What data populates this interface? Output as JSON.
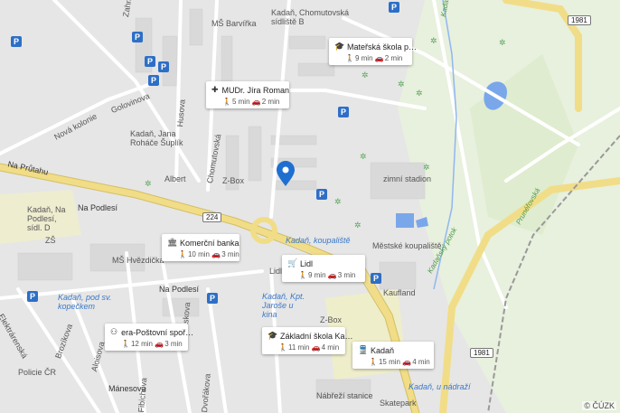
{
  "map": {
    "road_numbers": [
      "1981",
      "224",
      "1981"
    ],
    "street_labels": [
      "Zahradní",
      "Golovinova",
      "Nová kolonie",
      "Husova",
      "Chomutovská",
      "Na Průtahu",
      "Na Podlesí",
      "Na Podlesí",
      "Mánesova",
      "Brozíkova",
      "Aloisova",
      "Elektrárenská",
      "Fibichova",
      "Dvořákova",
      "Jiráskova",
      "Kadaňský potok",
      "Kadaňský potok",
      "Prunéřovská"
    ],
    "place_labels": [
      "Kadaň, Chomutovská sídliště B",
      "MŠ Barvířka",
      "Kadaň, Jana Roháče Šuplík",
      "Albert",
      "Z-Box",
      "zimní stadion",
      "Kadaň, Na Podlesí, sídl. D",
      "ZŠ",
      "MŠ Hvězdička",
      "Městské koupaliště",
      "Kaufland",
      "Policie ČR",
      "Z-Box",
      "Nábřeží stanice",
      "Skatepark",
      "Lidl"
    ],
    "transit_labels": [
      "Kadaň, koupaliště",
      "Kadaň, pod sv. kopečkem",
      "Kadaň, Kpt. Jaroše u kina",
      "Kadaň, u nádraží"
    ],
    "copyright": "© ČÚZK"
  },
  "cards": [
    {
      "icon": "school-icon",
      "glyph": "🎓",
      "title": "Mateřská škola p…",
      "walk": "9 min",
      "car": "2 min"
    },
    {
      "icon": "doctor-icon",
      "glyph": "✚",
      "title": "MUDr. Jíra Roman",
      "walk": "5 min",
      "car": "2 min"
    },
    {
      "icon": "bank-icon",
      "glyph": "🏛",
      "title": "Komerční banka",
      "walk": "10 min",
      "car": "3 min"
    },
    {
      "icon": "shop-icon",
      "glyph": "🛒",
      "title": "Lidl",
      "walk": "9 min",
      "car": "3 min"
    },
    {
      "icon": "atm-icon",
      "glyph": "⚇",
      "title": "era-Poštovní spoř…",
      "walk": "12 min",
      "car": "3 min"
    },
    {
      "icon": "school-icon",
      "glyph": "🎓",
      "title": "Základní škola Ka…",
      "walk": "11 min",
      "car": "4 min"
    },
    {
      "icon": "train-icon",
      "glyph": "🚆",
      "title": "Kadaň",
      "walk": "15 min",
      "car": "4 min"
    }
  ],
  "colors": {
    "marker": "#1f6fd1",
    "parking": "#2e6fc6",
    "road_main": "#f3e08a",
    "road_minor": "#ffffff",
    "park": "#e4efd9",
    "water": "#7aa7ea"
  }
}
